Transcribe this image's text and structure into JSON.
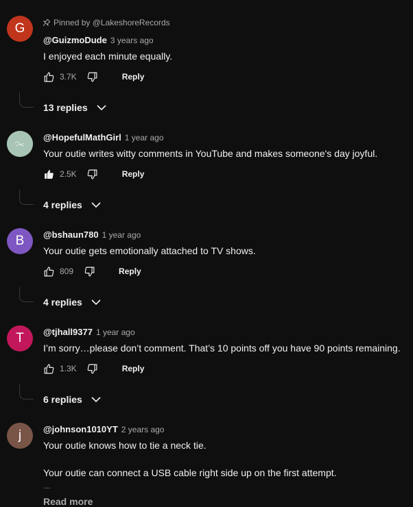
{
  "comments": [
    {
      "avatar_letter": "G",
      "avatar_color": "#c1351d",
      "pinned_label": "Pinned by @LakeshoreRecords",
      "author": "@GuizmoDude",
      "time": "3 years ago",
      "text": "I enjoyed each minute equally.",
      "likes": "3.7K",
      "reply_label": "Reply",
      "replies_label": "13 replies"
    },
    {
      "avatar_letter": "",
      "avatar_color": "#a7c4b5",
      "author": "@HopefulMathGirl",
      "time": "1 year ago",
      "text": "Your outie writes witty comments in YouTube and makes someone's day joyful.",
      "likes": "2.5K",
      "liked": true,
      "reply_label": "Reply",
      "replies_label": "4 replies"
    },
    {
      "avatar_letter": "B",
      "avatar_color": "#7e57c2",
      "author": "@bshaun780",
      "time": "1 year ago",
      "text": "Your outie gets emotionally attached to TV shows.",
      "likes": "809",
      "reply_label": "Reply",
      "replies_label": "4 replies"
    },
    {
      "avatar_letter": "T",
      "avatar_color": "#c2185b",
      "author": "@tjhall9377",
      "time": "1 year ago",
      "text": "I’m sorry…please don’t comment.  That’s 10 points off you have 90 points remaining.",
      "likes": "1.3K",
      "reply_label": "Reply",
      "replies_label": "6 replies"
    },
    {
      "avatar_letter": "j",
      "avatar_color": "#795548",
      "author": "@johnson1010YT",
      "time": "2 years ago",
      "text": "Your outie knows how to tie a neck tie.",
      "text2": "Your outie can connect a USB cable right side up on the first attempt.",
      "ellipsis": "…",
      "read_more": "Read more"
    }
  ]
}
